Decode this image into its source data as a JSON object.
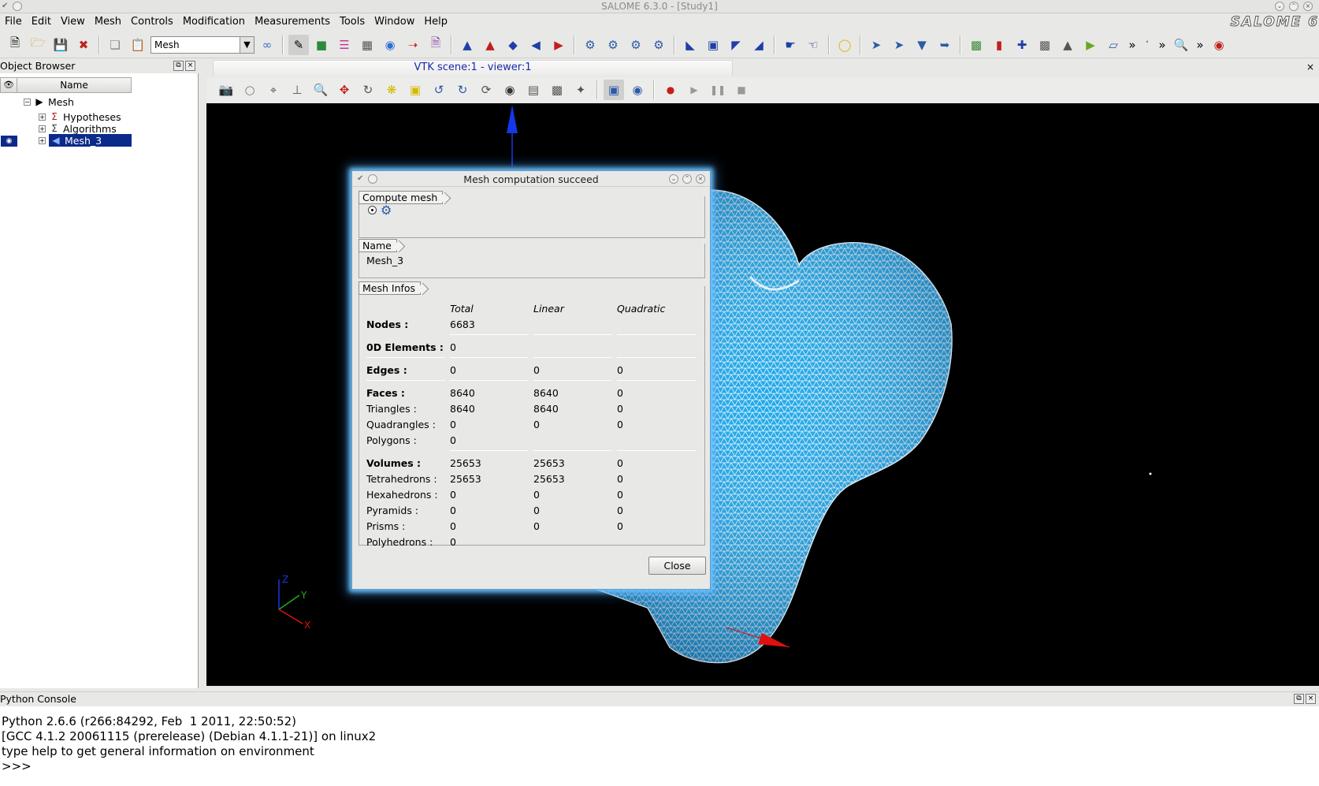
{
  "window": {
    "title": "SALOME 6.3.0 - [Study1]",
    "logo": "SALOME 6"
  },
  "menu": [
    "File",
    "Edit",
    "View",
    "Mesh",
    "Controls",
    "Modification",
    "Measurements",
    "Tools",
    "Window",
    "Help"
  ],
  "toolbar": {
    "module": "Mesh"
  },
  "object_browser": {
    "title": "Object Browser",
    "column": "Name",
    "root": "Mesh",
    "items": [
      "Hypotheses",
      "Algorithms",
      "Mesh_3"
    ]
  },
  "viewer": {
    "tab": "VTK scene:1 - viewer:1",
    "axes": {
      "x": "X",
      "y": "Y",
      "z": "Z"
    }
  },
  "dialog": {
    "title": "Mesh computation succeed",
    "group_compute": "Compute mesh",
    "group_name": "Name",
    "mesh_name": "Mesh_3",
    "group_infos": "Mesh Infos",
    "headers": {
      "total": "Total",
      "linear": "Linear",
      "quadratic": "Quadratic"
    },
    "rows": {
      "nodes": {
        "label": "Nodes :",
        "total": "6683"
      },
      "od": {
        "label": "0D Elements :",
        "total": "0"
      },
      "edges": {
        "label": "Edges :",
        "total": "0",
        "linear": "0",
        "quadratic": "0"
      },
      "faces": {
        "label": "Faces :",
        "total": "8640",
        "linear": "8640",
        "quadratic": "0"
      },
      "triangles": {
        "label": "Triangles :",
        "total": "8640",
        "linear": "8640",
        "quadratic": "0"
      },
      "quadrangles": {
        "label": "Quadrangles :",
        "total": "0",
        "linear": "0",
        "quadratic": "0"
      },
      "polygons": {
        "label": "Polygons :",
        "total": "0"
      },
      "volumes": {
        "label": "Volumes :",
        "total": "25653",
        "linear": "25653",
        "quadratic": "0"
      },
      "tetra": {
        "label": "Tetrahedrons :",
        "total": "25653",
        "linear": "25653",
        "quadratic": "0"
      },
      "hexa": {
        "label": "Hexahedrons :",
        "total": "0",
        "linear": "0",
        "quadratic": "0"
      },
      "pyr": {
        "label": "Pyramids :",
        "total": "0",
        "linear": "0",
        "quadratic": "0"
      },
      "prisms": {
        "label": "Prisms :",
        "total": "0",
        "linear": "0",
        "quadratic": "0"
      },
      "polyh": {
        "label": "Polyhedrons :",
        "total": "0"
      }
    },
    "close_label": "Close"
  },
  "console": {
    "title": "Python Console",
    "lines": [
      "Python 2.6.6 (r266:84292, Feb  1 2011, 22:50:52)",
      "[GCC 4.1.2 20061115 (prerelease) (Debian 4.1.1-21)] on linux2",
      "type help to get general information on environment",
      ">>>"
    ]
  },
  "colors": {
    "selection": "#0c2a8a",
    "mesh": "#1fa8e8",
    "viewer_bg": "#000000",
    "dialog_glow": "#6fc4ff"
  }
}
